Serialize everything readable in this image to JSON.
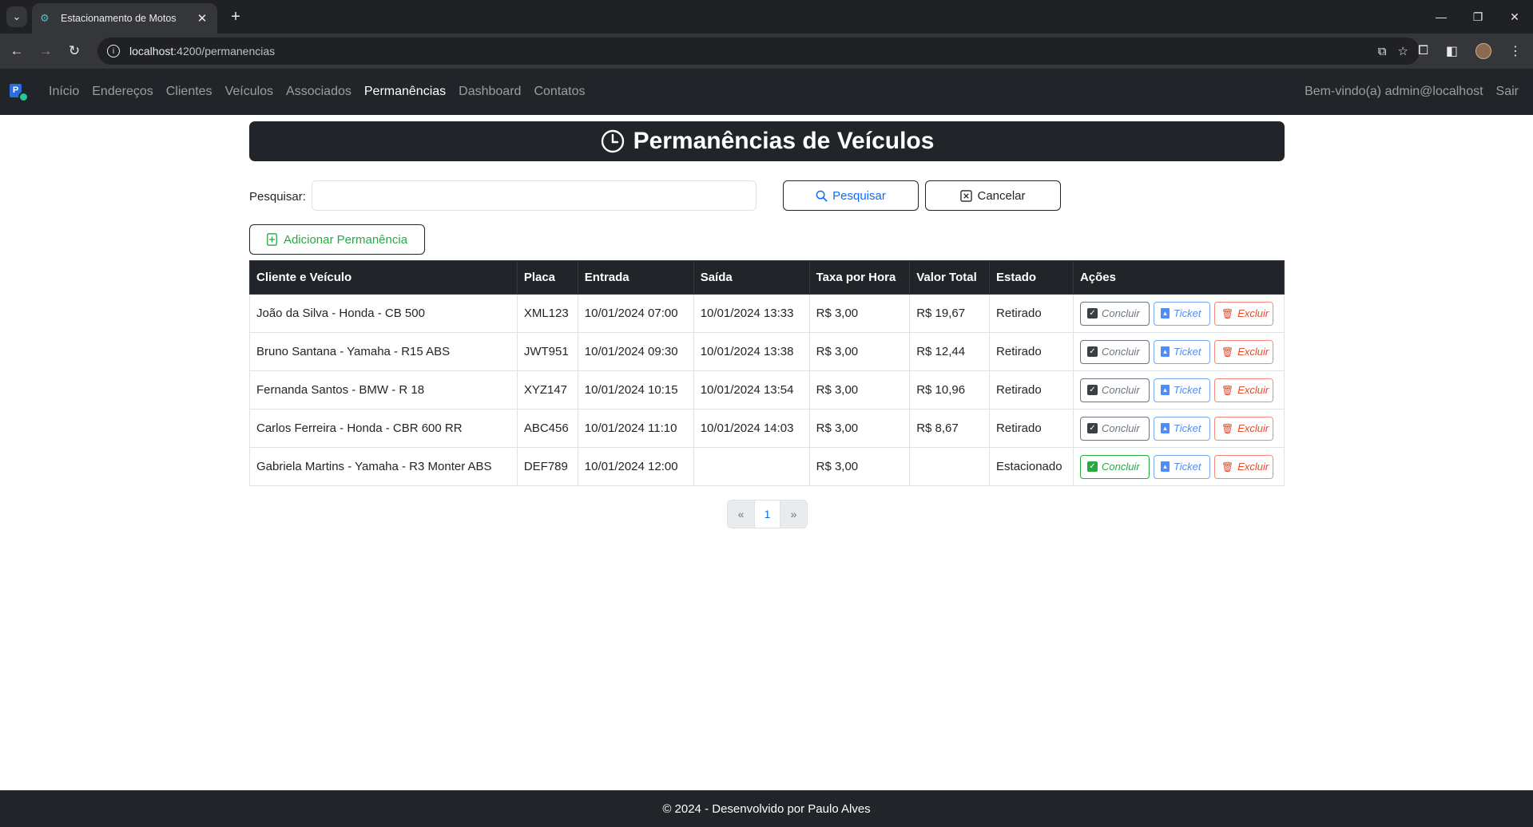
{
  "browser": {
    "tab_title": "Estacionamento de Motos",
    "url_host": "localhost",
    "url_path": ":4200/permanencias"
  },
  "nav": {
    "links": [
      "Início",
      "Endereços",
      "Clientes",
      "Veículos",
      "Associados",
      "Permanências",
      "Dashboard",
      "Contatos"
    ],
    "active": "Permanências",
    "welcome": "Bem-vindo(a) admin@localhost",
    "logout": "Sair"
  },
  "page": {
    "title": "Permanências de Veículos"
  },
  "search": {
    "label": "Pesquisar:",
    "value": "",
    "search_button": "Pesquisar",
    "cancel_button": "Cancelar"
  },
  "add_button": "Adicionar Permanência",
  "table": {
    "headers": [
      "Cliente e Veículo",
      "Placa",
      "Entrada",
      "Saída",
      "Taxa por Hora",
      "Valor Total",
      "Estado",
      "Ações"
    ],
    "rows": [
      {
        "cliente_veiculo": "João da Silva - Honda - CB 500",
        "placa": "XML123",
        "entrada": "10/01/2024 07:00",
        "saida": "10/01/2024 13:33",
        "taxa": "R$ 3,00",
        "valor_total": "R$ 19,67",
        "estado": "Retirado",
        "concluir_enabled": false
      },
      {
        "cliente_veiculo": "Bruno Santana - Yamaha - R15 ABS",
        "placa": "JWT951",
        "entrada": "10/01/2024 09:30",
        "saida": "10/01/2024 13:38",
        "taxa": "R$ 3,00",
        "valor_total": "R$ 12,44",
        "estado": "Retirado",
        "concluir_enabled": false
      },
      {
        "cliente_veiculo": "Fernanda Santos - BMW - R 18",
        "placa": "XYZ147",
        "entrada": "10/01/2024 10:15",
        "saida": "10/01/2024 13:54",
        "taxa": "R$ 3,00",
        "valor_total": "R$ 10,96",
        "estado": "Retirado",
        "concluir_enabled": false
      },
      {
        "cliente_veiculo": "Carlos Ferreira - Honda - CBR 600 RR",
        "placa": "ABC456",
        "entrada": "10/01/2024 11:10",
        "saida": "10/01/2024 14:03",
        "taxa": "R$ 3,00",
        "valor_total": "R$ 8,67",
        "estado": "Retirado",
        "concluir_enabled": false
      },
      {
        "cliente_veiculo": "Gabriela Martins - Yamaha - R3 Monter ABS",
        "placa": "DEF789",
        "entrada": "10/01/2024 12:00",
        "saida": "",
        "taxa": "R$ 3,00",
        "valor_total": "",
        "estado": "Estacionado",
        "concluir_enabled": true
      }
    ],
    "action_labels": {
      "concluir": "Concluir",
      "ticket": "Ticket",
      "excluir": "Excluir"
    }
  },
  "pagination": {
    "prev": "«",
    "pages": [
      "1"
    ],
    "next": "»"
  },
  "footer": "© 2024 - Desenvolvido por Paulo Alves",
  "colors": {
    "navbar": "#212529",
    "primary": "#0d6efd",
    "success": "#28a745",
    "danger": "#e64a2e"
  }
}
